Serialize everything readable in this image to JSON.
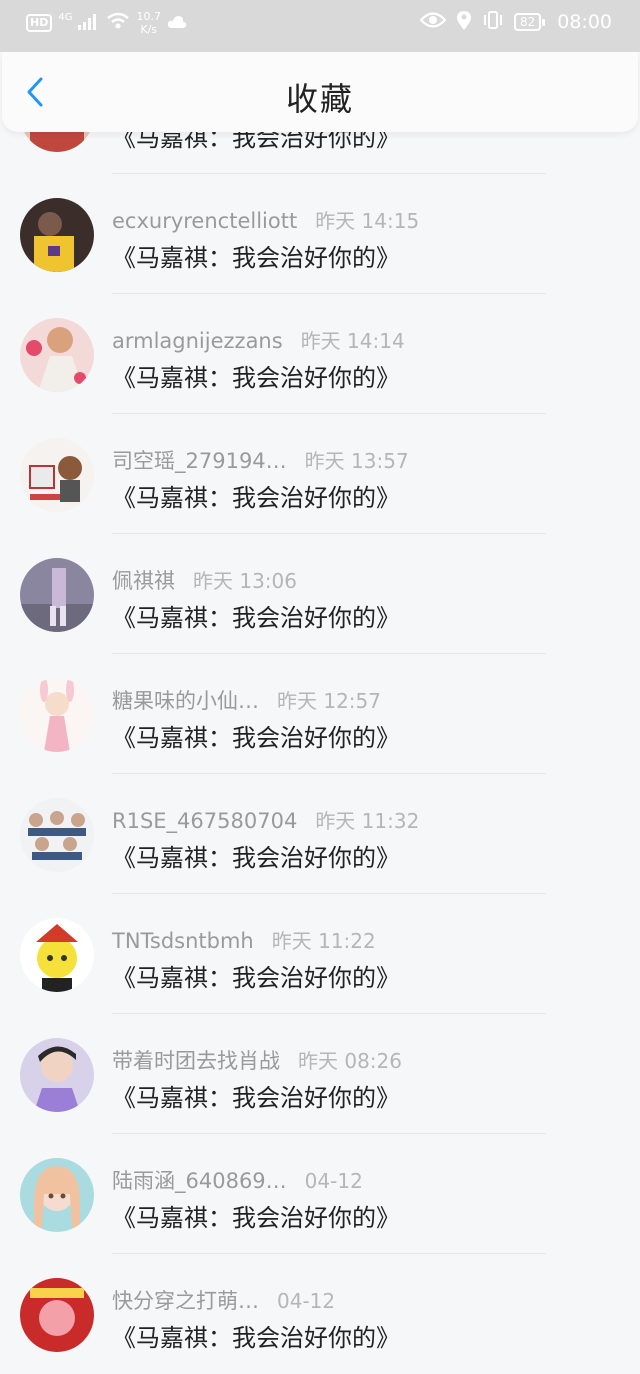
{
  "status_bar": {
    "hd": "HD",
    "network": "4G",
    "speed_value": "10.7",
    "speed_unit": "K/s",
    "battery": "82",
    "time": "08:00"
  },
  "header": {
    "title": "收藏"
  },
  "colors": {
    "accent": "#2196f3",
    "statusbar": "#d9d9d9"
  },
  "items": [
    {
      "user": "",
      "time": "",
      "message": "《马嘉祺：我会治好你的》"
    },
    {
      "user": "ecxuryrenctelliott",
      "time": "昨天 14:15",
      "message": "《马嘉祺：我会治好你的》"
    },
    {
      "user": "armlagnijezzans",
      "time": "昨天 14:14",
      "message": "《马嘉祺：我会治好你的》"
    },
    {
      "user": "司空瑶_279194…",
      "time": "昨天 13:57",
      "message": "《马嘉祺：我会治好你的》"
    },
    {
      "user": "佩祺祺",
      "time": "昨天 13:06",
      "message": "《马嘉祺：我会治好你的》"
    },
    {
      "user": "糖果味的小仙…",
      "time": "昨天 12:57",
      "message": "《马嘉祺：我会治好你的》"
    },
    {
      "user": "R1SE_467580704",
      "time": "昨天 11:32",
      "message": "《马嘉祺：我会治好你的》"
    },
    {
      "user": "TNTsdsntbmh",
      "time": "昨天 11:22",
      "message": "《马嘉祺：我会治好你的》"
    },
    {
      "user": "带着时团去找肖战",
      "time": "昨天 08:26",
      "message": "《马嘉祺：我会治好你的》"
    },
    {
      "user": "陆雨涵_640869…",
      "time": "04-12",
      "message": "《马嘉祺：我会治好你的》"
    },
    {
      "user": "快分穿之打萌…",
      "time": "04-12",
      "message": "《马嘉祺：我会治好你的》"
    }
  ]
}
